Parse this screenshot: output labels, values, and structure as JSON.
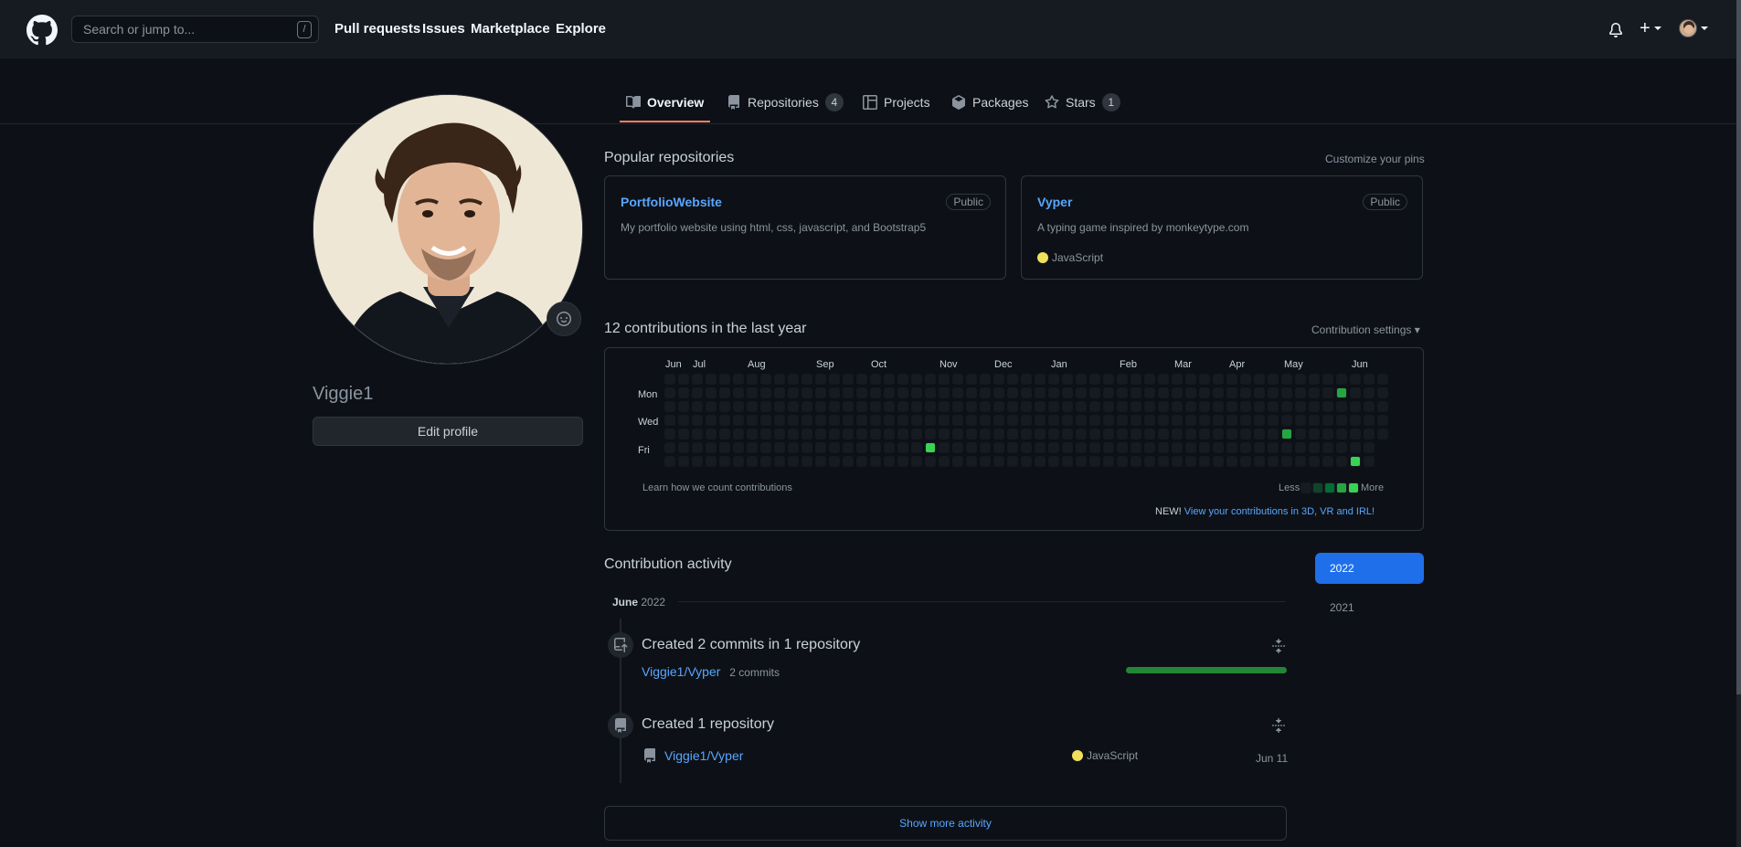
{
  "header": {
    "search_placeholder": "Search or jump to...",
    "search_shortcut": "/",
    "nav": [
      "Pull requests",
      "Issues",
      "Marketplace",
      "Explore"
    ],
    "plus_label": "+",
    "icons": [
      "github-logo-icon",
      "bell-icon",
      "plus-icon",
      "avatar"
    ]
  },
  "tabs": [
    {
      "label": "Overview",
      "icon": "book-icon",
      "active": true
    },
    {
      "label": "Repositories",
      "icon": "repo-icon",
      "count": "4"
    },
    {
      "label": "Projects",
      "icon": "table-icon"
    },
    {
      "label": "Packages",
      "icon": "package-icon"
    },
    {
      "label": "Stars",
      "icon": "star-icon",
      "count": "1"
    }
  ],
  "profile": {
    "username": "Viggie1",
    "edit_label": "Edit profile"
  },
  "popular": {
    "title": "Popular repositories",
    "customize_label": "Customize your pins",
    "pins": [
      {
        "name": "PortfolioWebsite",
        "visibility": "Public",
        "description": "My portfolio website using html, css, javascript, and Bootstrap5",
        "language": ""
      },
      {
        "name": "Vyper",
        "visibility": "Public",
        "description": "A typing game inspired by monkeytype.com",
        "language": "JavaScript",
        "language_color": "#f1e05a"
      }
    ]
  },
  "contributions": {
    "title": "12 contributions in the last year",
    "settings_label": "Contribution settings ▾",
    "months": [
      "Jun",
      "Jul",
      "Aug",
      "Sep",
      "Oct",
      "Nov",
      "Dec",
      "Jan",
      "Feb",
      "Mar",
      "Apr",
      "May",
      "Jun"
    ],
    "days": [
      "Mon",
      "Wed",
      "Fri"
    ],
    "learn_label": "Learn how we count contributions",
    "legend_less": "Less",
    "legend_more": "More",
    "new_label": "NEW!",
    "view_3d_label": "View your contributions in 3D, VR and IRL!",
    "level_colors": [
      "#161b22",
      "#0e4429",
      "#006d32",
      "#26a641",
      "#39d353"
    ],
    "active_cells": [
      {
        "week": 19,
        "day": 5,
        "level": 4
      },
      {
        "week": 45,
        "day": 4,
        "level": 3
      },
      {
        "week": 49,
        "day": 1,
        "level": 3
      },
      {
        "week": 50,
        "day": 6,
        "level": 4
      }
    ]
  },
  "activity": {
    "title": "Contribution activity",
    "month_label": "June",
    "year_label": "2022",
    "years": [
      "2022",
      "2021"
    ],
    "items": [
      {
        "title": "Created 2 commits in 1 repository",
        "repo": "Viggie1/Vyper",
        "detail": "2 commits",
        "progress": 1.0
      },
      {
        "title": "Created 1 repository",
        "repo": "Viggie1/Vyper",
        "language": "JavaScript",
        "date": "Jun 11"
      }
    ],
    "show_more_label": "Show more activity"
  }
}
